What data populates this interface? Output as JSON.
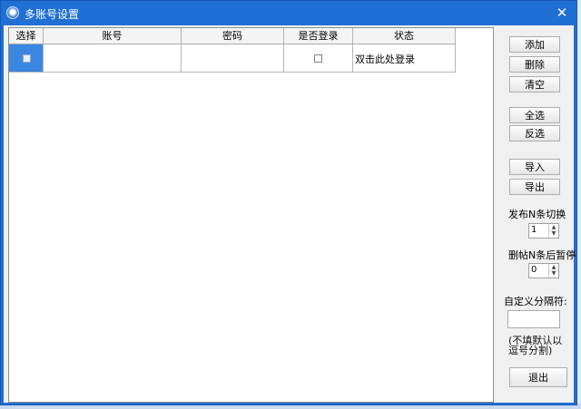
{
  "window": {
    "title": "多账号设置",
    "close_glyph": "✕"
  },
  "grid": {
    "columns": [
      "选择",
      "账号",
      "密码",
      "是否登录",
      "状态"
    ],
    "rows": [
      {
        "selected": false,
        "account": "",
        "password": "",
        "logged_in": false,
        "status": "双击此处登录"
      }
    ]
  },
  "buttons": {
    "add": "添加",
    "delete": "删除",
    "clear": "清空",
    "select_all": "全选",
    "invert": "反选",
    "import": "导入",
    "export": "导出",
    "exit": "退出"
  },
  "settings": {
    "switch_label": "发布N条切换",
    "switch_value": "1",
    "pause_label": "删帖N条后暂停",
    "pause_value": "0",
    "separator_label": "自定义分隔符:",
    "separator_value": "",
    "separator_hint": "(不填默认以逗号分割)"
  },
  "icons": [
    "app-icon",
    "close-icon",
    "spin-up-icon",
    "spin-down-icon"
  ],
  "colors": {
    "titlebar": "#1f6fd4",
    "selected_cell": "#3b86e0",
    "panel": "#f0f0f0"
  }
}
